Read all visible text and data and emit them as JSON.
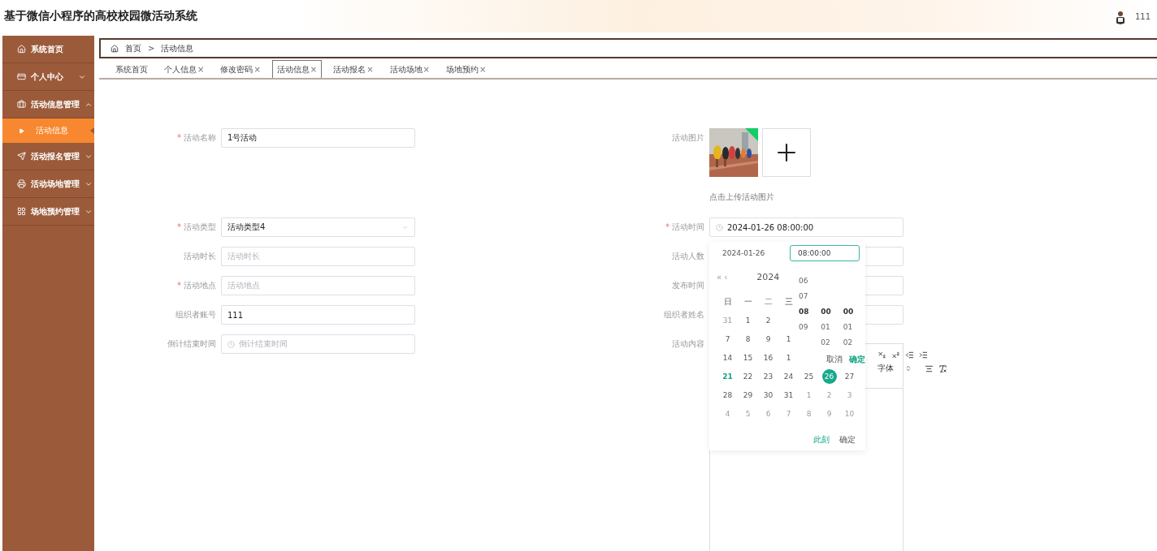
{
  "app_title": "基于微信小程序的高校校园微活动系统",
  "user": {
    "name": "111"
  },
  "sidebar": [
    {
      "label": "系统首页"
    },
    {
      "label": "个人中心",
      "expanded": false
    },
    {
      "label": "活动信息管理",
      "expanded": true,
      "children": [
        {
          "label": "活动信息",
          "selected": true
        }
      ]
    },
    {
      "label": "活动报名管理",
      "expanded": false
    },
    {
      "label": "活动场地管理",
      "expanded": false
    },
    {
      "label": "场地预约管理",
      "expanded": false
    }
  ],
  "breadcrumb": {
    "items": [
      "首页",
      "活动信息"
    ],
    "separator": ">"
  },
  "tabs": {
    "close_mark": "×",
    "items": [
      {
        "label": "系统首页",
        "closable": false,
        "selected": false
      },
      {
        "label": "个人信息",
        "closable": true,
        "selected": false
      },
      {
        "label": "修改密码",
        "closable": true,
        "selected": false
      },
      {
        "label": "活动信息",
        "closable": true,
        "selected": true
      },
      {
        "label": "活动报名",
        "closable": true,
        "selected": false
      },
      {
        "label": "活动场地",
        "closable": true,
        "selected": false
      },
      {
        "label": "场地预约",
        "closable": true,
        "selected": false
      }
    ]
  },
  "form": {
    "required_mark": "*",
    "left": [
      {
        "label": "活动名称",
        "required": true,
        "kind": "input",
        "value": "1号活动"
      },
      {
        "label": "活动类型",
        "required": true,
        "kind": "select",
        "value": "活动类型4"
      },
      {
        "label": "活动时长",
        "required": false,
        "kind": "input",
        "placeholder": "活动时长"
      },
      {
        "label": "活动地点",
        "required": true,
        "kind": "input",
        "placeholder": "活动地点"
      },
      {
        "label": "组织者账号",
        "required": false,
        "kind": "input",
        "value": "111"
      },
      {
        "label": "倒计结束时间",
        "required": false,
        "kind": "date",
        "placeholder": "倒计结束时间"
      }
    ],
    "right": [
      {
        "label": "活动图片",
        "required": false,
        "kind": "upload",
        "hint": "点击上传活动图片"
      },
      {
        "label": "活动时间",
        "required": true,
        "kind": "date",
        "value": "2024-01-26 08:00:00"
      },
      {
        "label": "活动人数",
        "required": false,
        "kind": "input"
      },
      {
        "label": "发布时间",
        "required": false,
        "kind": "input"
      },
      {
        "label": "组织者姓名",
        "required": false,
        "kind": "input"
      },
      {
        "label": "活动内容",
        "required": false,
        "kind": "editor"
      }
    ]
  },
  "date_picker": {
    "date_value": "2024-01-26",
    "time_value": "08:00:00",
    "nav": "« ‹",
    "year": "2024",
    "weekdays": [
      "日",
      "一",
      "二",
      "三"
    ],
    "weeks": [
      [
        {
          "day": "31",
          "muted": true,
          "today": false,
          "selected": false
        },
        {
          "day": "1",
          "muted": false,
          "today": false,
          "selected": false
        },
        {
          "day": "2",
          "muted": false,
          "today": false,
          "selected": false
        }
      ],
      [
        {
          "day": "7",
          "muted": false,
          "today": false,
          "selected": false
        },
        {
          "day": "8",
          "muted": false,
          "today": false,
          "selected": false
        },
        {
          "day": "9",
          "muted": false,
          "today": false,
          "selected": false
        },
        {
          "day": "1",
          "muted": false,
          "today": false,
          "selected": false
        }
      ],
      [
        {
          "day": "14",
          "muted": false,
          "today": false,
          "selected": false
        },
        {
          "day": "15",
          "muted": false,
          "today": false,
          "selected": false
        },
        {
          "day": "16",
          "muted": false,
          "today": false,
          "selected": false
        },
        {
          "day": "1",
          "muted": false,
          "today": false,
          "selected": false
        }
      ],
      [
        {
          "day": "21",
          "muted": false,
          "today": true,
          "selected": false
        },
        {
          "day": "22",
          "muted": false,
          "today": false,
          "selected": false
        },
        {
          "day": "23",
          "muted": false,
          "today": false,
          "selected": false
        },
        {
          "day": "24",
          "muted": false,
          "today": false,
          "selected": false
        },
        {
          "day": "25",
          "muted": false,
          "today": false,
          "selected": false
        },
        {
          "day": "26",
          "muted": false,
          "today": false,
          "selected": true
        },
        {
          "day": "27",
          "muted": false,
          "today": false,
          "selected": false
        }
      ],
      [
        {
          "day": "28",
          "muted": false,
          "today": false,
          "selected": false
        },
        {
          "day": "29",
          "muted": false,
          "today": false,
          "selected": false
        },
        {
          "day": "30",
          "muted": false,
          "today": false,
          "selected": false
        },
        {
          "day": "31",
          "muted": false,
          "today": false,
          "selected": false
        },
        {
          "day": "1",
          "muted": true,
          "today": false,
          "selected": false
        },
        {
          "day": "2",
          "muted": true,
          "today": false,
          "selected": false
        },
        {
          "day": "3",
          "muted": true,
          "today": false,
          "selected": false
        }
      ],
      [
        {
          "day": "4",
          "muted": true,
          "today": false,
          "selected": false
        },
        {
          "day": "5",
          "muted": true,
          "today": false,
          "selected": false
        },
        {
          "day": "6",
          "muted": true,
          "today": false,
          "selected": false
        },
        {
          "day": "7",
          "muted": true,
          "today": false,
          "selected": false
        },
        {
          "day": "8",
          "muted": true,
          "today": false,
          "selected": false
        },
        {
          "day": "9",
          "muted": true,
          "today": false,
          "selected": false
        },
        {
          "day": "10",
          "muted": true,
          "today": false,
          "selected": false
        }
      ]
    ],
    "now": "此刻",
    "ok": "确定",
    "time_columns": [
      [
        {
          "v": "06",
          "selected": false
        },
        {
          "v": "07",
          "selected": false
        },
        {
          "v": "08",
          "selected": true
        },
        {
          "v": "09",
          "selected": false
        }
      ],
      [
        {
          "v": "00",
          "selected": true
        },
        {
          "v": "01",
          "selected": false
        },
        {
          "v": "02",
          "selected": false
        }
      ],
      [
        {
          "v": "00",
          "selected": true
        },
        {
          "v": "01",
          "selected": false
        },
        {
          "v": "02",
          "selected": false
        }
      ]
    ],
    "time_cancel": "取消",
    "time_confirm": "确定"
  },
  "editor": {
    "toolbar_row_1": [
      {
        "kind": "subscript"
      },
      {
        "kind": "superscript"
      },
      {
        "kind": "outdent"
      },
      {
        "kind": "indent"
      }
    ],
    "font_label": "字体",
    "toolbar_row_2": [
      {
        "kind": "align"
      },
      {
        "kind": "clean"
      }
    ]
  }
}
